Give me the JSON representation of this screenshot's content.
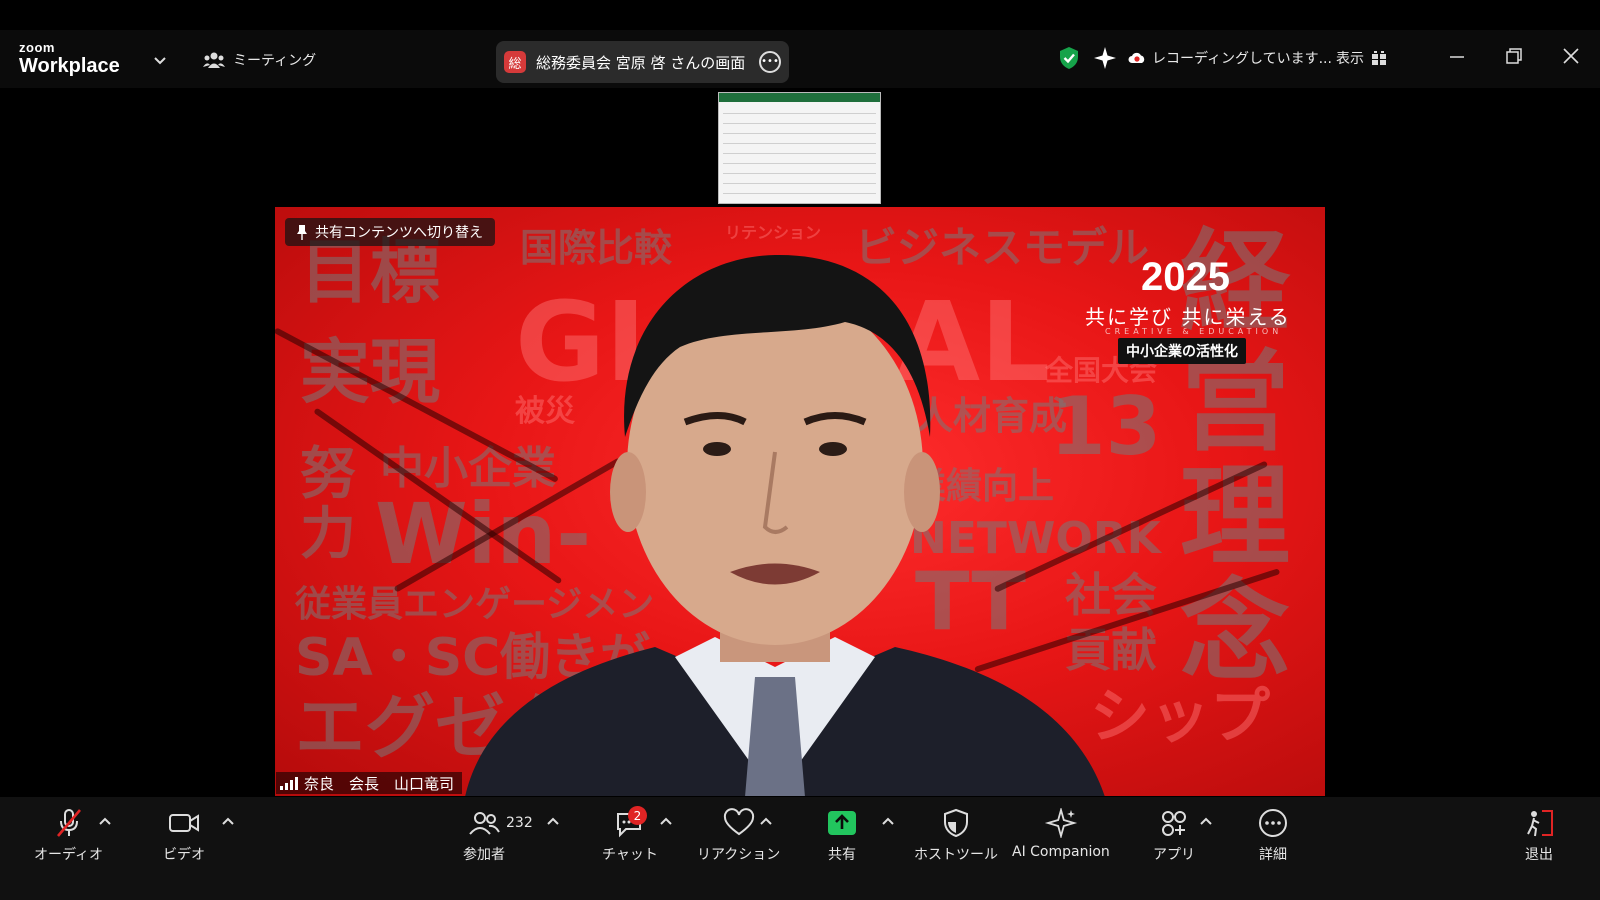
{
  "window": {
    "brand_line1": "zoom",
    "brand_line2": "Workplace",
    "meeting_label": "ミーティング",
    "share_badge": "総",
    "share_title": "総務委員会 宮原 啓 さんの画面",
    "recording_status": "レコーディングしています...",
    "view_label": "表示"
  },
  "video": {
    "switch_button": "共有コンテンツへ切り替え",
    "slide": {
      "year": "2025",
      "slogan": "共に学び 共に栄える",
      "slogan_sub": "CREATIVE & EDUCATION",
      "theme": "中小企業の活性化",
      "words": [
        "目標",
        "実現",
        "努",
        "力",
        "国際比較",
        "リテンション",
        "ビジネスモデル",
        "GL",
        "AL",
        "中小企業",
        "Win-",
        "従業員エンゲージメン",
        "SA・SC",
        "働きが",
        "エグゼク",
        "被災",
        "人材育成",
        "13",
        "業績向上",
        "NETWORK",
        "TT",
        "社会",
        "貢献",
        "経",
        "営",
        "理",
        "念",
        "シップ",
        "全国大会"
      ]
    },
    "speaker_name": "奈良　会長　山口竜司"
  },
  "toolbar": {
    "audio": "オーディオ",
    "video": "ビデオ",
    "participants": "参加者",
    "participants_count": "232",
    "chat": "チャット",
    "chat_badge": "2",
    "reactions": "リアクション",
    "share": "共有",
    "host_tools": "ホストツール",
    "ai_companion": "AI Companion",
    "apps": "アプリ",
    "more": "詳細",
    "leave": "退出"
  },
  "colors": {
    "share_green": "#22c55e",
    "shield_green": "#16a34a",
    "muted_red": "#e02424",
    "slide_red": "#e81616"
  }
}
